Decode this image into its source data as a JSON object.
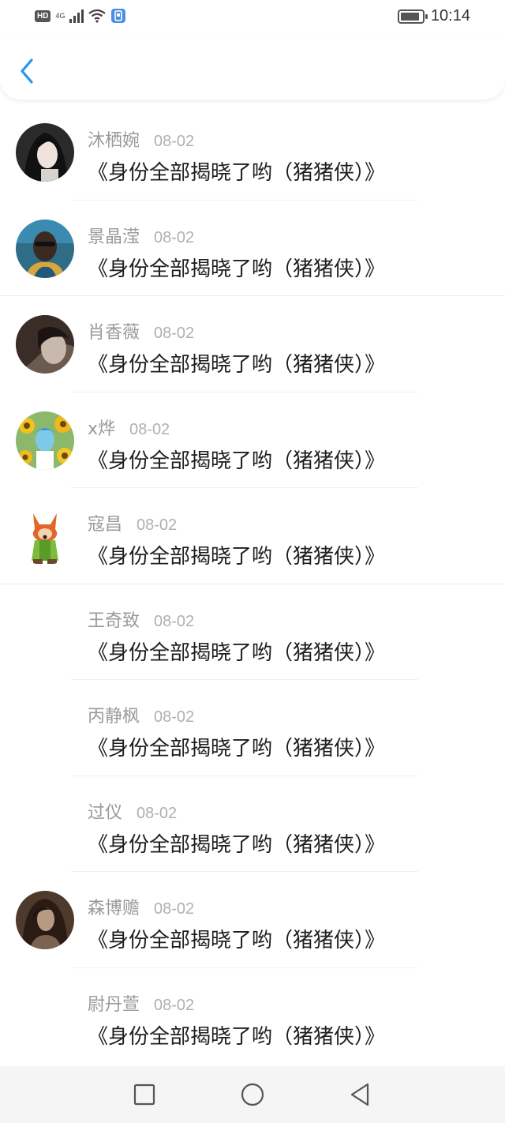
{
  "status_bar": {
    "hd": "HD",
    "network": "4G",
    "time": "10:14",
    "battery_level": 0.9,
    "icons": [
      "hd-icon",
      "signal-icon",
      "wifi-icon",
      "app-notification-icon",
      "battery-icon"
    ]
  },
  "header": {
    "back_icon": "chevron-left-icon",
    "accent": "#2196f3"
  },
  "comments": [
    {
      "name": "沐栖婉",
      "date": "08-02",
      "text": "《身份全部揭晓了哟（猪猪侠）》"
    },
    {
      "name": "景晶滢",
      "date": "08-02",
      "text": "《身份全部揭晓了哟（猪猪侠）》"
    },
    {
      "name": "肖香薇",
      "date": "08-02",
      "text": "《身份全部揭晓了哟（猪猪侠）》"
    },
    {
      "name": "x烨",
      "date": "08-02",
      "text": "《身份全部揭晓了哟（猪猪侠）》"
    },
    {
      "name": "寇昌",
      "date": "08-02",
      "text": "《身份全部揭晓了哟（猪猪侠）》"
    },
    {
      "name": "王奇致",
      "date": "08-02",
      "text": "《身份全部揭晓了哟（猪猪侠）》"
    },
    {
      "name": "丙静枫",
      "date": "08-02",
      "text": "《身份全部揭晓了哟（猪猪侠）》"
    },
    {
      "name": "过仪",
      "date": "08-02",
      "text": "《身份全部揭晓了哟（猪猪侠）》"
    },
    {
      "name": "森博赡",
      "date": "08-02",
      "text": "《身份全部揭晓了哟（猪猪侠）》"
    },
    {
      "name": "尉丹萱",
      "date": "08-02",
      "text": "《身份全部揭晓了哟（猪猪侠）》"
    }
  ],
  "nav_bar": {
    "icons": [
      "recent-apps-square-icon",
      "home-circle-icon",
      "back-triangle-icon"
    ]
  }
}
